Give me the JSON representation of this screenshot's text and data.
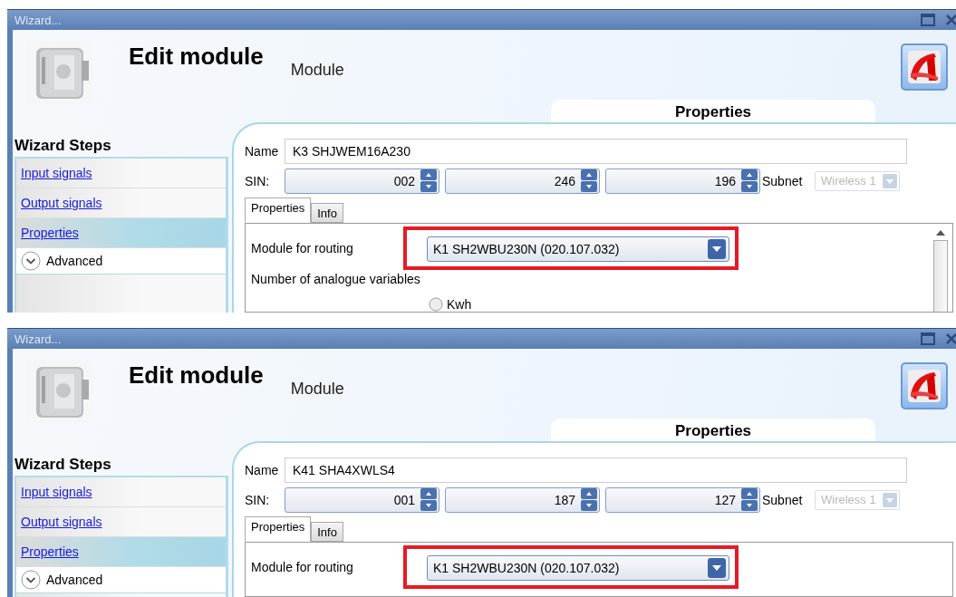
{
  "screens": [
    {
      "window": {
        "title": "Wizard..."
      },
      "header": {
        "title": "Edit module",
        "subtitle": "Module"
      },
      "section_tab": "Properties",
      "wizard_steps": {
        "title": "Wizard Steps",
        "items": [
          {
            "label": "Input signals",
            "kind": "link",
            "selected": false
          },
          {
            "label": "Output signals",
            "kind": "link",
            "selected": false
          },
          {
            "label": "Properties",
            "kind": "link",
            "selected": true
          },
          {
            "label": "Advanced",
            "kind": "expander",
            "selected": false
          }
        ]
      },
      "form": {
        "name_label": "Name",
        "name_value": "K3 SHJWEM16A230",
        "sin_label": "SIN:",
        "sin": [
          "002",
          "246",
          "196"
        ],
        "subnet_label": "Subnet",
        "subnet_value": "Wireless 1",
        "subnet_disabled": true,
        "tabs": [
          {
            "label": "Properties",
            "selected": true
          },
          {
            "label": "Info",
            "selected": false
          }
        ],
        "scrollbar": true,
        "fields": [
          {
            "kind": "dropdown",
            "label": "Module for routing",
            "value": "K1 SH2WBU230N (020.107.032)",
            "highlighted": true
          },
          {
            "kind": "heading",
            "label": "Number of analogue variables"
          },
          {
            "kind": "radio",
            "label": "Kwh",
            "checked": false
          }
        ]
      }
    },
    {
      "window": {
        "title": "Wizard..."
      },
      "header": {
        "title": "Edit module",
        "subtitle": "Module"
      },
      "section_tab": "Properties",
      "wizard_steps": {
        "title": "Wizard Steps",
        "items": [
          {
            "label": "Input signals",
            "kind": "link",
            "selected": false
          },
          {
            "label": "Output signals",
            "kind": "link",
            "selected": false
          },
          {
            "label": "Properties",
            "kind": "link",
            "selected": true
          },
          {
            "label": "Advanced",
            "kind": "expander",
            "selected": false
          }
        ]
      },
      "form": {
        "name_label": "Name",
        "name_value": "K41 SHA4XWLS4",
        "sin_label": "SIN:",
        "sin": [
          "001",
          "187",
          "127"
        ],
        "subnet_label": "Subnet",
        "subnet_value": "Wireless 1",
        "subnet_disabled": true,
        "tabs": [
          {
            "label": "Properties",
            "selected": true
          },
          {
            "label": "Info",
            "selected": false
          }
        ],
        "scrollbar": false,
        "fields": [
          {
            "kind": "dropdown",
            "label": "Module for routing",
            "value": "K1 SH2WBU230N (020.107.032)",
            "highlighted": true
          }
        ]
      }
    }
  ]
}
